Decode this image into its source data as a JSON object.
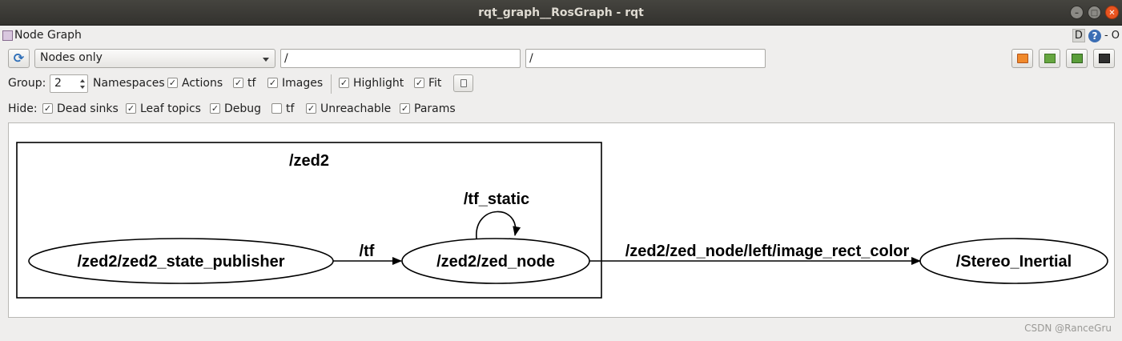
{
  "window": {
    "title": "rqt_graph__RosGraph - rqt",
    "buttons": [
      "–",
      "□",
      "✕"
    ]
  },
  "plugin": {
    "title": "Node Graph",
    "dock_label": "D",
    "help_label": "?",
    "close_label": "- O"
  },
  "toolbar": {
    "refresh_icon": "⟳",
    "mode": "Nodes only",
    "filter1": "/",
    "filter2": "/",
    "icons": [
      "load-icon",
      "save-dot-icon",
      "save-image-icon",
      "save-svg-icon"
    ]
  },
  "row2": {
    "group_label": "Group:",
    "group_value": "2",
    "namespaces": "Namespaces",
    "namespaces_checked": true,
    "actions": "Actions",
    "actions_checked": true,
    "tf": "tf",
    "tf_checked": true,
    "images": "Images",
    "images_checked": true,
    "highlight": "Highlight",
    "highlight_checked": true,
    "fit": "Fit",
    "fit_checked": true
  },
  "row3": {
    "hide_label": "Hide:",
    "dead_sinks": "Dead sinks",
    "dead_sinks_checked": true,
    "leaf_topics": "Leaf topics",
    "leaf_topics_checked": true,
    "debug": "Debug",
    "debug_checked": true,
    "tf": "tf",
    "tf_checked": false,
    "unreachable": "Unreachable",
    "unreachable_checked": true,
    "params": "Params",
    "params_checked": true
  },
  "graph": {
    "cluster_label": "/zed2",
    "nodes": {
      "publisher": "/zed2/zed2_state_publisher",
      "zed_node": "/zed2/zed_node",
      "stereo": "/Stereo_Inertial"
    },
    "edges": {
      "tf": "/tf",
      "tf_static": "/tf_static",
      "image": "/zed2/zed_node/left/image_rect_color"
    }
  },
  "watermark": "CSDN @RanceGru"
}
